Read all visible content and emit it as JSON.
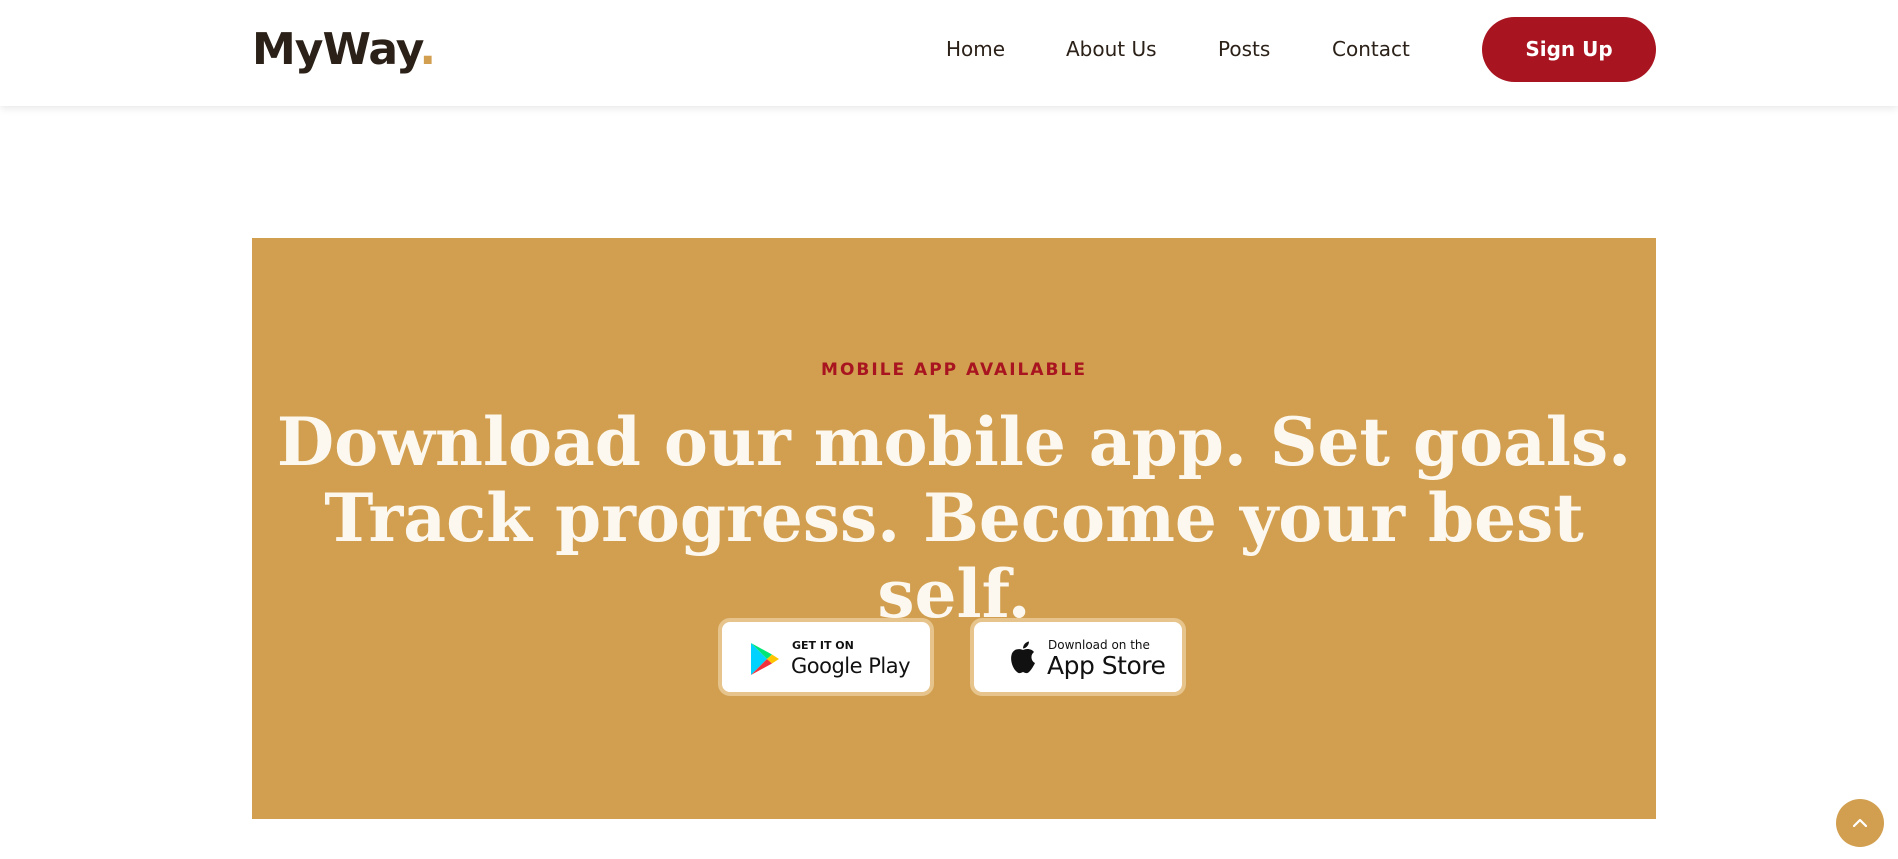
{
  "brand": {
    "name": "MyWay",
    "dot": ".",
    "accent_color": "#d19f4f",
    "text_color": "#2b2118"
  },
  "nav": {
    "items": [
      {
        "label": "Home"
      },
      {
        "label": "About Us"
      },
      {
        "label": "Posts"
      },
      {
        "label": "Contact"
      }
    ],
    "cta_label": "Sign Up",
    "cta_color": "#a8141f"
  },
  "banner": {
    "background": "#d19f4f",
    "eyebrow": "MOBILE APP AVAILABLE",
    "headline_line1": "Download our mobile app. Set goals.",
    "headline_line2": "Track progress. Become your best self.",
    "stores": [
      {
        "icon": "google-play-icon",
        "small_text": "GET IT ON",
        "big_text": "Google Play"
      },
      {
        "icon": "apple-icon",
        "small_text": "Download on the",
        "big_text": "App Store"
      }
    ]
  },
  "scroll_top": {
    "icon": "chevron-up-icon"
  }
}
